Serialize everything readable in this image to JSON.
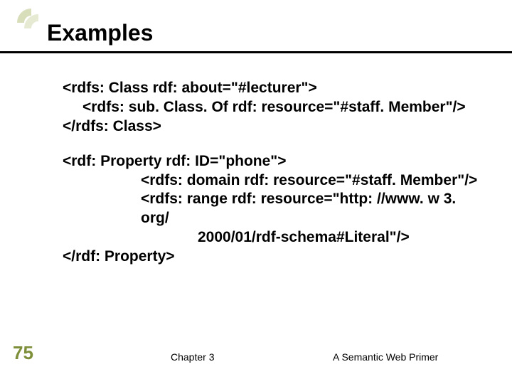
{
  "title": "Examples",
  "code": {
    "block1": {
      "l1": "<rdfs: Class rdf: about=\"#lecturer\">",
      "l2": "<rdfs: sub. Class. Of rdf: resource=\"#staff. Member\"/>",
      "l3": "</rdfs: Class>"
    },
    "block2": {
      "l1": "<rdf: Property rdf: ID=\"phone\">",
      "l2": "<rdfs: domain rdf: resource=\"#staff. Member\"/>",
      "l3": "<rdfs: range rdf: resource=\"http: //www. w 3. org/",
      "l4": "2000/01/rdf-schema#Literal\"/>",
      "l5": "</rdf: Property>"
    }
  },
  "slide_number": "75",
  "footer_left": "Chapter 3",
  "footer_right": "A Semantic Web Primer",
  "colors": {
    "accent": "#7e8f3a"
  }
}
